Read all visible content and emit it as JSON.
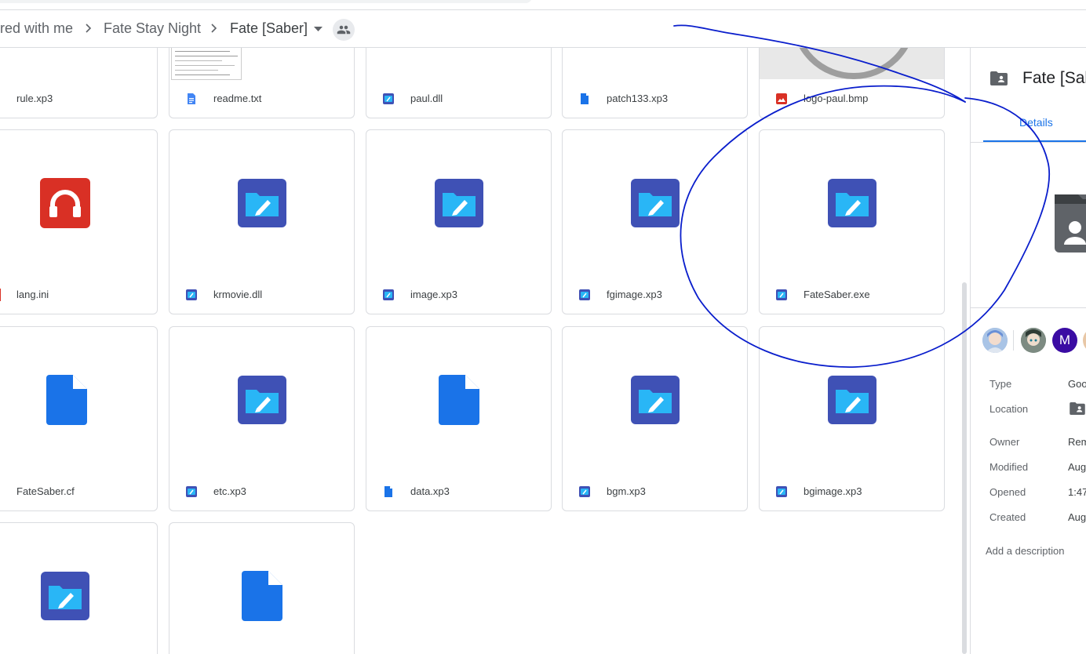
{
  "breadcrumb": {
    "items": [
      "red with me",
      "Fate Stay Night",
      "Fate [Saber]"
    ]
  },
  "files": [
    {
      "name": "rule.xp3",
      "type": "binary"
    },
    {
      "name": "readme.txt",
      "type": "doc"
    },
    {
      "name": "paul.dll",
      "type": "binary"
    },
    {
      "name": "patch133.xp3",
      "type": "doc"
    },
    {
      "name": "logo-paul.bmp",
      "type": "image"
    },
    {
      "name": "lang.ini",
      "type": "audio"
    },
    {
      "name": "krmovie.dll",
      "type": "binary"
    },
    {
      "name": "image.xp3",
      "type": "binary"
    },
    {
      "name": "fgimage.xp3",
      "type": "binary"
    },
    {
      "name": "FateSaber.exe",
      "type": "binary"
    },
    {
      "name": "FateSaber.cf",
      "type": "doc"
    },
    {
      "name": "etc.xp3",
      "type": "binary"
    },
    {
      "name": "data.xp3",
      "type": "doc"
    },
    {
      "name": "bgm.xp3",
      "type": "binary"
    },
    {
      "name": "bgimage.xp3",
      "type": "binary"
    },
    {
      "name": "",
      "type": "binary"
    },
    {
      "name": "",
      "type": "doc"
    }
  ],
  "details_panel": {
    "title": "Fate [Sal",
    "tab": "Details",
    "avatar_letter": "M",
    "properties": [
      {
        "label": "Type",
        "value": "Goo"
      },
      {
        "label": "Location",
        "value": ""
      },
      {
        "label": "Owner",
        "value": "Rem"
      },
      {
        "label": "Modified",
        "value": "Aug"
      },
      {
        "label": "Opened",
        "value": "1:47"
      },
      {
        "label": "Created",
        "value": "Aug"
      }
    ],
    "add_description": "Add a description"
  },
  "colors": {
    "accent": "#1a73e8",
    "binary_icon": "#3f51b5",
    "audio_icon": "#d93025",
    "annotation": "#0a1ecc"
  },
  "icons": [
    "chevron-right-icon",
    "dropdown-arrow-icon",
    "people-icon",
    "shared-folder-icon",
    "doc-icon",
    "binary-icon",
    "audio-icon",
    "image-icon"
  ]
}
